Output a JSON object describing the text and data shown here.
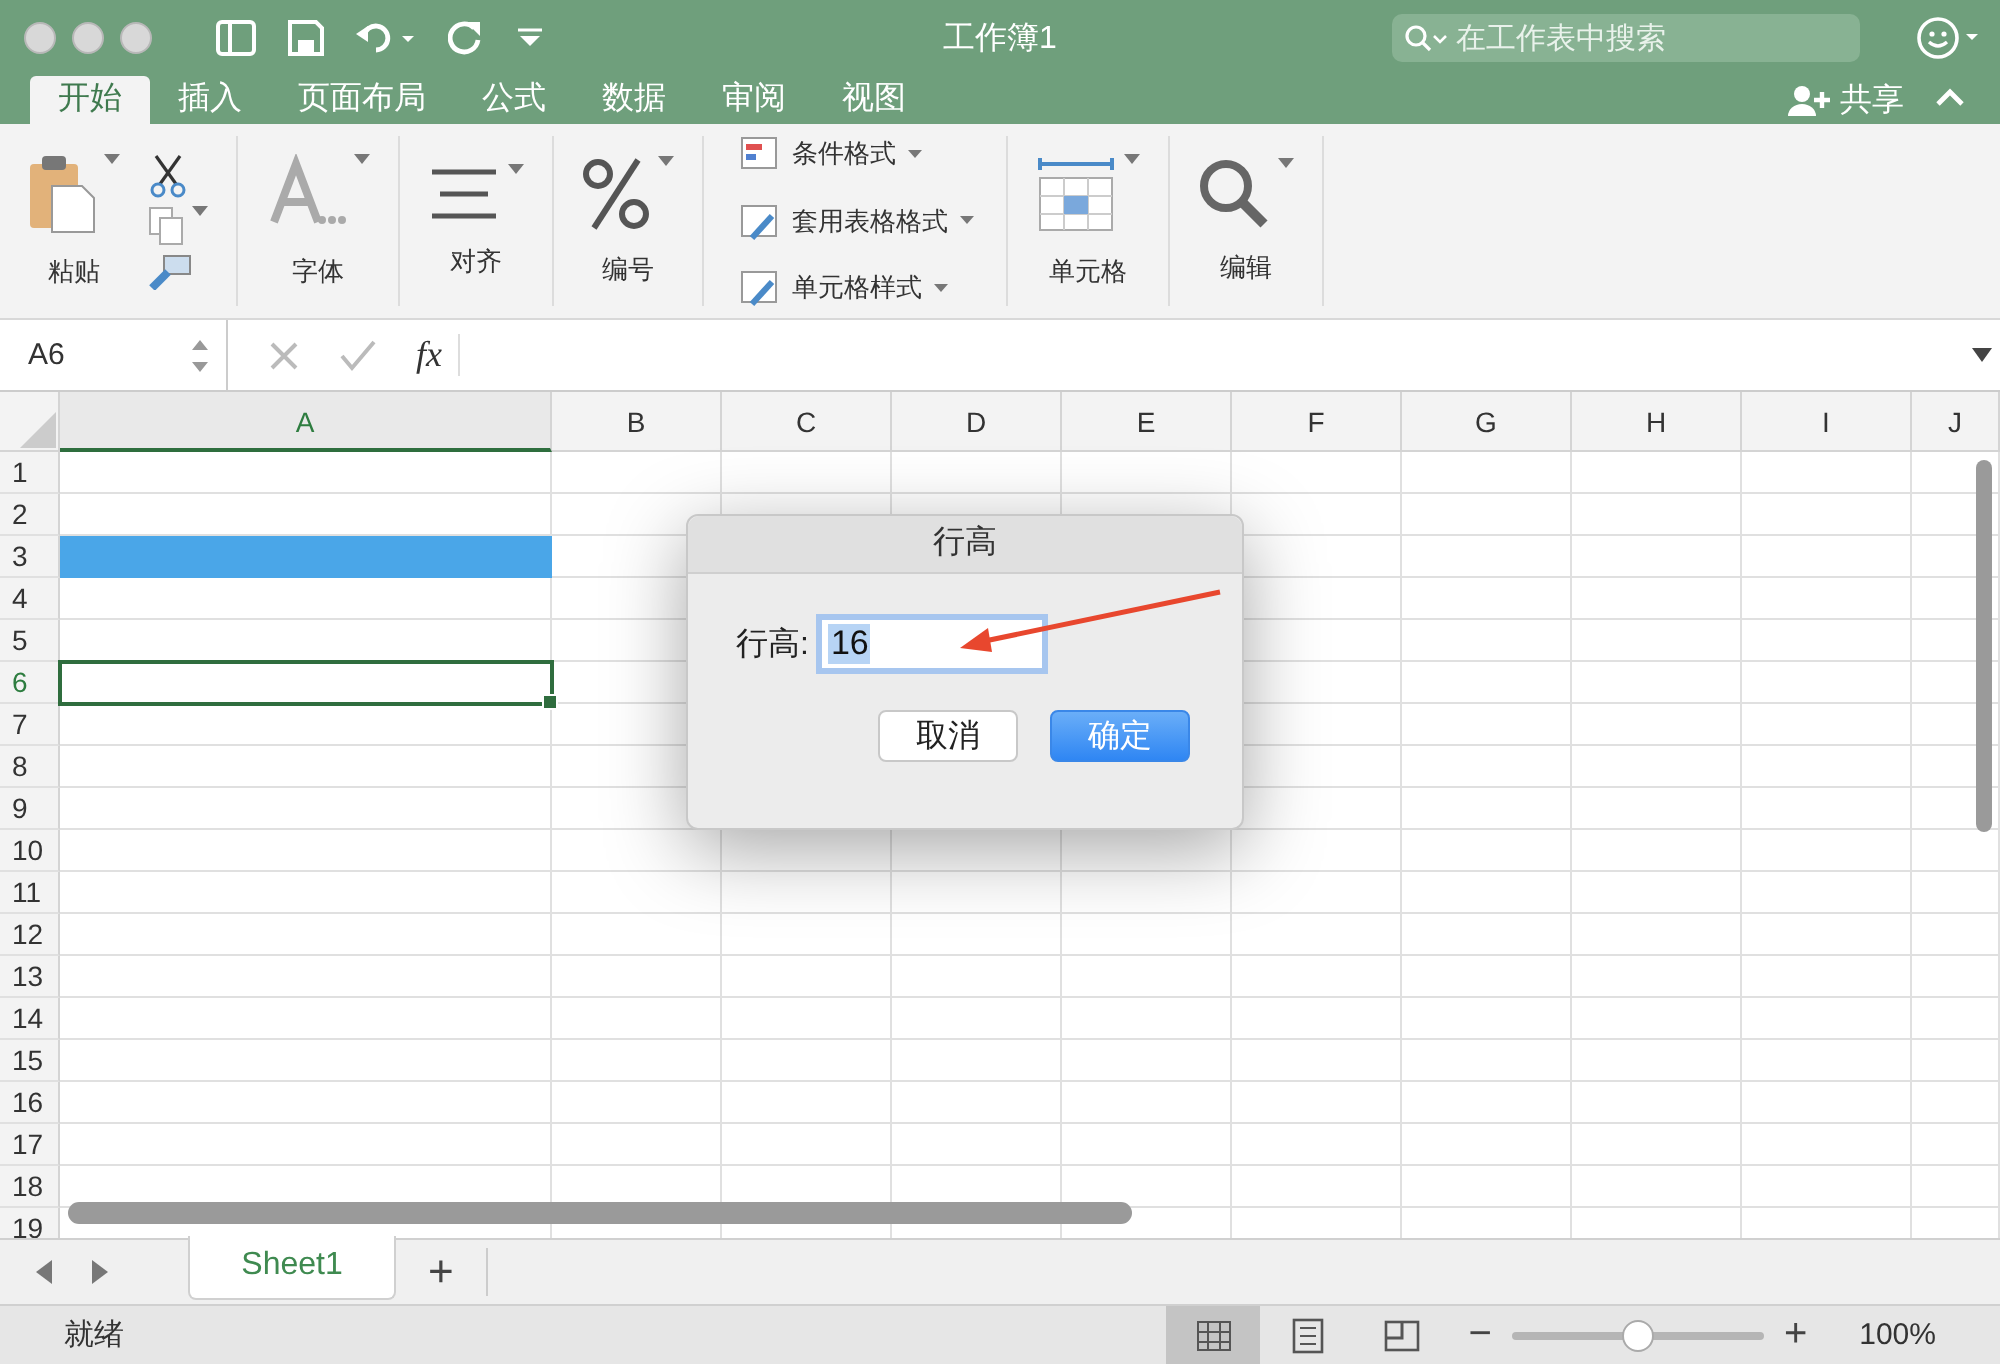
{
  "window": {
    "title": "工作簿1"
  },
  "search": {
    "placeholder": "在工作表中搜索"
  },
  "tabs": [
    {
      "label": "开始",
      "selected": true
    },
    {
      "label": "插入",
      "selected": false
    },
    {
      "label": "页面布局",
      "selected": false
    },
    {
      "label": "公式",
      "selected": false
    },
    {
      "label": "数据",
      "selected": false
    },
    {
      "label": "审阅",
      "selected": false
    },
    {
      "label": "视图",
      "selected": false
    }
  ],
  "share": {
    "label": "共享"
  },
  "ribbon": [
    {
      "kind": "paste",
      "label": "粘贴"
    },
    {
      "kind": "font",
      "label": "字体"
    },
    {
      "kind": "align",
      "label": "对齐"
    },
    {
      "kind": "number",
      "label": "编号"
    },
    {
      "kind": "styles",
      "items": [
        "条件格式",
        "套用表格格式",
        "单元格样式"
      ]
    },
    {
      "kind": "cells",
      "label": "单元格"
    },
    {
      "kind": "edit",
      "label": "编辑"
    }
  ],
  "formula_bar": {
    "name_box": "A6",
    "fx": "fx"
  },
  "columns": [
    {
      "label": "A",
      "selected": true
    },
    {
      "label": "B",
      "selected": false
    },
    {
      "label": "C",
      "selected": false
    },
    {
      "label": "D",
      "selected": false
    },
    {
      "label": "E",
      "selected": false
    },
    {
      "label": "F",
      "selected": false
    },
    {
      "label": "G",
      "selected": false
    },
    {
      "label": "H",
      "selected": false
    },
    {
      "label": "I",
      "selected": false
    },
    {
      "label": "J",
      "selected": false
    }
  ],
  "rows": [
    {
      "label": "1",
      "selected": false,
      "highlighted": false
    },
    {
      "label": "2",
      "selected": false,
      "highlighted": false
    },
    {
      "label": "3",
      "selected": false,
      "highlighted": true
    },
    {
      "label": "4",
      "selected": false,
      "highlighted": false
    },
    {
      "label": "5",
      "selected": false,
      "highlighted": false
    },
    {
      "label": "6",
      "selected": true,
      "highlighted": false
    },
    {
      "label": "7",
      "selected": false,
      "highlighted": false
    },
    {
      "label": "8",
      "selected": false,
      "highlighted": false
    },
    {
      "label": "9",
      "selected": false,
      "highlighted": false
    },
    {
      "label": "10",
      "selected": false,
      "highlighted": false
    },
    {
      "label": "11",
      "selected": false,
      "highlighted": false
    },
    {
      "label": "12",
      "selected": false,
      "highlighted": false
    },
    {
      "label": "13",
      "selected": false,
      "highlighted": false
    },
    {
      "label": "14",
      "selected": false,
      "highlighted": false
    },
    {
      "label": "15",
      "selected": false,
      "highlighted": false
    },
    {
      "label": "16",
      "selected": false,
      "highlighted": false
    },
    {
      "label": "17",
      "selected": false,
      "highlighted": false
    },
    {
      "label": "18",
      "selected": false,
      "highlighted": false
    },
    {
      "label": "19",
      "selected": false,
      "highlighted": false
    }
  ],
  "dialog": {
    "title": "行高",
    "field_label": "行高:",
    "value": "16",
    "value_selected": true,
    "buttons": [
      {
        "label": "取消",
        "kind": "secondary"
      },
      {
        "label": "确定",
        "kind": "default"
      }
    ]
  },
  "sheet_tabs": [
    {
      "label": "Sheet1",
      "selected": true
    }
  ],
  "add_sheet": "+",
  "status_bar": {
    "text": "就绪",
    "views": [
      {
        "kind": "normal",
        "selected": true
      },
      {
        "kind": "page-layout",
        "selected": false
      },
      {
        "kind": "page-break",
        "selected": false
      }
    ],
    "zoom": {
      "minus": "−",
      "plus": "+",
      "level": 0.5,
      "reading": "100%"
    }
  }
}
